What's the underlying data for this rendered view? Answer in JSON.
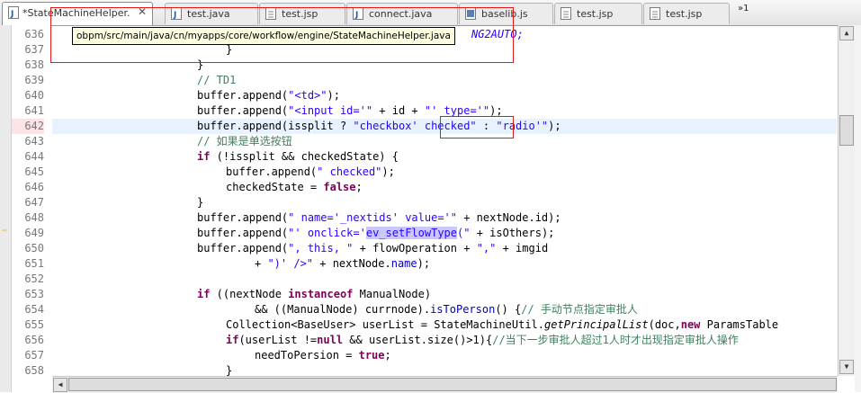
{
  "tabs": [
    {
      "label": "*StateMachineHelper.",
      "active": true,
      "icon": "java-file-icon",
      "closable": true
    },
    {
      "label": "test.java",
      "icon": "java-file-icon"
    },
    {
      "label": "test.jsp",
      "icon": "jsp-file-icon"
    },
    {
      "label": "connect.java",
      "icon": "java-file-icon"
    },
    {
      "label": "baselib.js",
      "icon": "js-file-icon"
    },
    {
      "label": "test.jsp",
      "icon": "jsp-file-icon"
    },
    {
      "label": "test.jsp",
      "icon": "jsp-file-icon"
    }
  ],
  "overflow_label": "»1",
  "tooltip": "obpm/src/main/java/cn/myapps/core/workflow/engine/StateMachineHelper.java",
  "partial_line_636": "NG2AUTO;",
  "current_line": "642",
  "lines": [
    {
      "n": "636"
    },
    {
      "n": "637"
    },
    {
      "n": "638"
    },
    {
      "n": "639"
    },
    {
      "n": "640"
    },
    {
      "n": "641"
    },
    {
      "n": "642"
    },
    {
      "n": "643"
    },
    {
      "n": "644"
    },
    {
      "n": "645"
    },
    {
      "n": "646"
    },
    {
      "n": "647"
    },
    {
      "n": "648"
    },
    {
      "n": "649"
    },
    {
      "n": "650"
    },
    {
      "n": "651"
    },
    {
      "n": "652"
    },
    {
      "n": "653"
    },
    {
      "n": "654"
    },
    {
      "n": "655"
    },
    {
      "n": "656"
    },
    {
      "n": "657"
    },
    {
      "n": "658"
    }
  ],
  "code": {
    "l637": "}",
    "l638": "}",
    "l639": "// TD1",
    "l640_a": "buffer.append(",
    "l640_s": "\"<td>\"",
    "l640_b": ");",
    "l641_a": "buffer.append(",
    "l641_s1": "\"<input id='\"",
    "l641_b": " + id + ",
    "l641_s2": "\"' type='\"",
    "l641_c": ");",
    "l642_a": "buffer.append(issplit ? ",
    "l642_s1": "\"checkbox' checked\"",
    "l642_b": " : ",
    "l642_s2": "\"radio'\"",
    "l642_c": ");",
    "l643": "// 如果是单选按钮",
    "l644_kw": "if",
    "l644_b": " (!issplit && checkedState) {",
    "l645_a": "buffer.append(",
    "l645_s": "\" checked\"",
    "l645_b": ");",
    "l646_a": "checkedState = ",
    "l646_kw": "false",
    "l646_b": ";",
    "l647": "}",
    "l648_a": "buffer.append(",
    "l648_s1": "\" name='_nextids' value='\"",
    "l648_b": " + nextNode.id);",
    "l649_a": "buffer.append(",
    "l649_s1": "\"' onclick='",
    "l649_hl": "ev_setFlowType",
    "l649_s2": "(\"",
    "l649_b": " + isOthers);",
    "l650_a": "buffer.append(",
    "l650_s1": "\", this, \"",
    "l650_b": " + flowOperation + ",
    "l650_s2": "\",\"",
    "l650_c": " + imgid",
    "l651_a": "+ ",
    "l651_s": "\")' />\"",
    "l651_b": " + nextNode.",
    "l651_f": "name",
    "l651_c": ");",
    "l653_kw1": "if",
    "l653_b": " ((nextNode ",
    "l653_kw2": "instanceof",
    "l653_c": " ManualNode)",
    "l654_a": "&& ((ManualNode) currnode).",
    "l654_f": "isToPerson",
    "l654_b": "() {",
    "l654_cmt": "// 手动节点指定审批人",
    "l655_a": "Collection<BaseUser> userList = StateMachineUtil.",
    "l655_i": "getPrincipalList",
    "l655_b": "(doc,",
    "l655_kw": "new",
    "l655_c": " ParamsTable",
    "l656_kw1": "if",
    "l656_b": "(userList !=",
    "l656_kw2": "null",
    "l656_c": " && userList.size()>1){",
    "l656_cmt": "//当下一步审批人超过1人时才出现指定审批人操作",
    "l657_a": "needToPersion = ",
    "l657_kw": "true",
    "l657_b": ";",
    "l658": "}"
  },
  "colors": {
    "keyword": "#7f0055",
    "string": "#2a00ff",
    "comment": "#3f7f5f",
    "current_line_bg": "#e8f2fe",
    "annotation_red": "#e01818"
  }
}
